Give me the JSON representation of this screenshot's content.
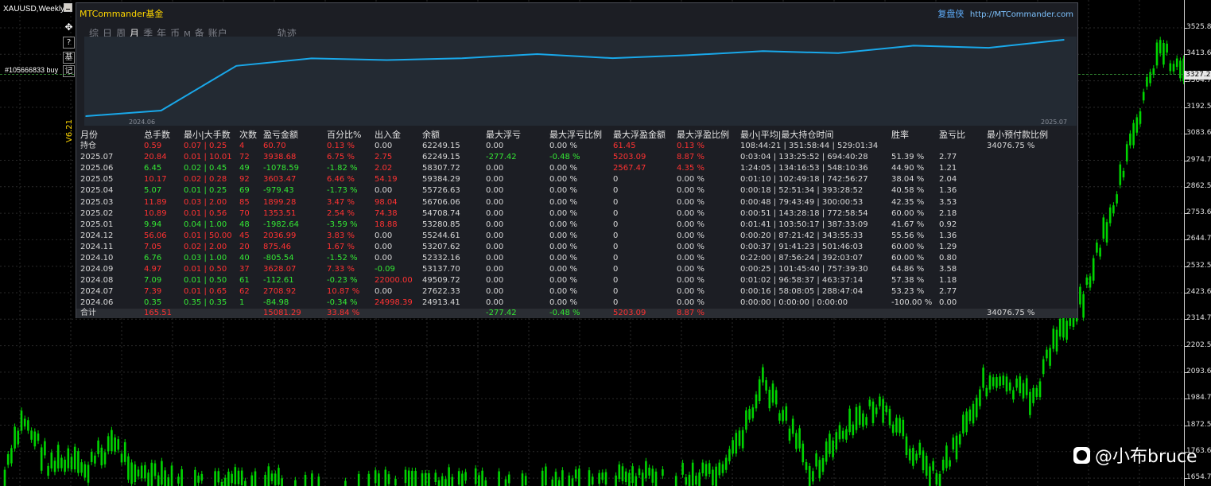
{
  "chart": {
    "symbol": "XAUUSD,Weekly",
    "order_label": "#105666833 buy",
    "version": "V6.21",
    "current_price": "3327.20",
    "price_ticks": [
      "3525.80",
      "3413.60",
      "3304.70",
      "3192.50",
      "3083.60",
      "2974.70",
      "2862.50",
      "2753.60",
      "2644.70",
      "2532.50",
      "2423.60",
      "2314.70",
      "2202.50",
      "2093.60",
      "1984.70",
      "1872.50",
      "1763.60",
      "1654.70"
    ],
    "side_buttons": {
      "move": "✥",
      "help": "?",
      "fund": "基",
      "record": "记"
    },
    "colors": {
      "candles": "#00d400",
      "grid": "#2a2a2a",
      "background": "#000000"
    }
  },
  "panel": {
    "brand": "MTCommander基金",
    "header_right_cn": "复盘侠",
    "header_right_url": "http://MTCommander.com",
    "tabs": [
      {
        "label": "综",
        "active": false
      },
      {
        "label": "日",
        "active": false
      },
      {
        "label": "周",
        "active": false
      },
      {
        "label": "月",
        "active": true
      },
      {
        "label": "季",
        "active": false
      },
      {
        "label": "年",
        "active": false
      },
      {
        "label": "币",
        "active": false
      },
      {
        "label": "M",
        "active": false
      },
      {
        "label": "备",
        "active": false
      },
      {
        "label": "账户",
        "active": false
      },
      {
        "label": "轨迹",
        "active": false
      }
    ],
    "equity": {
      "start_label": "2024.06",
      "end_label": "2025.07",
      "balances": [
        24913.41,
        27622.33,
        49509.72,
        53137.7,
        52332.16,
        53207.62,
        55244.61,
        53280.85,
        54708.74,
        56706.06,
        55726.63,
        59384.29,
        58307.72,
        62249.15
      ],
      "line_color": "#19a8ea"
    },
    "headers": [
      "月份",
      "总手数",
      "最小|大手数",
      "次数",
      "盈亏金额",
      "百分比%",
      "出入金",
      "余额",
      "最大浮亏",
      "最大浮亏比例",
      "最大浮盈金额",
      "最大浮盈比例",
      "最小|平均|最大持仓时间",
      "胜率",
      "盈亏比",
      "最小预付款比例"
    ],
    "rows": [
      {
        "c": [
          "持仓",
          "0.59",
          "0.07 | 0.25",
          "4",
          "60.70",
          "0.13 %",
          "0.00",
          "62249.15",
          "0.00",
          "0.00 %",
          "61.45",
          "0.13 %",
          "108:44:21 | 351:58:44 | 529:01:34",
          "",
          "",
          "34076.75 %"
        ],
        "k": [
          "w",
          "r",
          "r",
          "r",
          "r",
          "r",
          "w",
          "w",
          "w",
          "w",
          "r",
          "r",
          "w",
          "w",
          "w",
          "w"
        ]
      },
      {
        "c": [
          "2025.07",
          "20.84",
          "0.01 | 10.01",
          "72",
          "3938.68",
          "6.75 %",
          "2.75",
          "62249.15",
          "-277.42",
          "-0.48 %",
          "5203.09",
          "8.87 %",
          "0:03:04 | 133:25:52 | 694:40:28",
          "51.39 %",
          "2.77",
          ""
        ],
        "k": [
          "w",
          "r",
          "r",
          "r",
          "r",
          "r",
          "r",
          "w",
          "g",
          "g",
          "r",
          "r",
          "w",
          "w",
          "w",
          "w"
        ]
      },
      {
        "c": [
          "2025.06",
          "6.45",
          "0.02 | 0.45",
          "49",
          "-1078.59",
          "-1.82 %",
          "2.02",
          "58307.72",
          "0.00",
          "0.00 %",
          "2567.47",
          "4.35 %",
          "1:24:05 | 134:16:53 | 548:10:36",
          "44.90 %",
          "1.21",
          ""
        ],
        "k": [
          "w",
          "g",
          "g",
          "g",
          "g",
          "g",
          "r",
          "w",
          "w",
          "w",
          "r",
          "r",
          "w",
          "w",
          "w",
          "w"
        ]
      },
      {
        "c": [
          "2025.05",
          "10.17",
          "0.02 | 0.28",
          "92",
          "3603.47",
          "6.46 %",
          "54.19",
          "59384.29",
          "0.00",
          "0.00 %",
          "0",
          "0.00 %",
          "0:01:10 | 102:49:18 | 742:56:27",
          "38.04 %",
          "2.04",
          ""
        ],
        "k": [
          "w",
          "r",
          "r",
          "r",
          "r",
          "r",
          "r",
          "w",
          "w",
          "w",
          "w",
          "w",
          "w",
          "w",
          "w",
          "w"
        ]
      },
      {
        "c": [
          "2025.04",
          "5.07",
          "0.01 | 0.25",
          "69",
          "-979.43",
          "-1.73 %",
          "0.00",
          "55726.63",
          "0.00",
          "0.00 %",
          "0",
          "0.00 %",
          "0:00:18 | 52:51:34 | 393:28:52",
          "40.58 %",
          "1.36",
          ""
        ],
        "k": [
          "w",
          "g",
          "g",
          "g",
          "g",
          "g",
          "w",
          "w",
          "w",
          "w",
          "w",
          "w",
          "w",
          "w",
          "w",
          "w"
        ]
      },
      {
        "c": [
          "2025.03",
          "11.89",
          "0.03 | 2.00",
          "85",
          "1899.28",
          "3.47 %",
          "98.04",
          "56706.06",
          "0.00",
          "0.00 %",
          "0",
          "0.00 %",
          "0:00:48 | 79:43:49 | 300:00:53",
          "42.35 %",
          "3.53",
          ""
        ],
        "k": [
          "w",
          "r",
          "r",
          "r",
          "r",
          "r",
          "r",
          "w",
          "w",
          "w",
          "w",
          "w",
          "w",
          "w",
          "w",
          "w"
        ]
      },
      {
        "c": [
          "2025.02",
          "10.89",
          "0.01 | 0.56",
          "70",
          "1353.51",
          "2.54 %",
          "74.38",
          "54708.74",
          "0.00",
          "0.00 %",
          "0",
          "0.00 %",
          "0:00:51 | 143:28:18 | 772:58:54",
          "60.00 %",
          "2.18",
          ""
        ],
        "k": [
          "w",
          "r",
          "r",
          "r",
          "r",
          "r",
          "r",
          "w",
          "w",
          "w",
          "w",
          "w",
          "w",
          "w",
          "w",
          "w"
        ]
      },
      {
        "c": [
          "2025.01",
          "9.94",
          "0.04 | 1.00",
          "48",
          "-1982.64",
          "-3.59 %",
          "18.88",
          "53280.85",
          "0.00",
          "0.00 %",
          "0",
          "0.00 %",
          "0:01:41 | 103:50:17 | 387:33:09",
          "41.67 %",
          "0.92",
          ""
        ],
        "k": [
          "w",
          "g",
          "g",
          "g",
          "g",
          "g",
          "r",
          "w",
          "w",
          "w",
          "w",
          "w",
          "w",
          "w",
          "w",
          "w"
        ]
      },
      {
        "c": [
          "2024.12",
          "56.06",
          "0.01 | 50.00",
          "45",
          "2036.99",
          "3.83 %",
          "0.00",
          "55244.61",
          "0.00",
          "0.00 %",
          "0",
          "0.00 %",
          "0:00:20 | 87:21:42 | 343:55:33",
          "55.56 %",
          "1.36",
          ""
        ],
        "k": [
          "w",
          "r",
          "r",
          "r",
          "r",
          "r",
          "w",
          "w",
          "w",
          "w",
          "w",
          "w",
          "w",
          "w",
          "w",
          "w"
        ]
      },
      {
        "c": [
          "2024.11",
          "7.05",
          "0.02 | 2.00",
          "20",
          "875.46",
          "1.67 %",
          "0.00",
          "53207.62",
          "0.00",
          "0.00 %",
          "0",
          "0.00 %",
          "0:00:37 | 91:41:23 | 501:46:03",
          "60.00 %",
          "1.29",
          ""
        ],
        "k": [
          "w",
          "r",
          "r",
          "r",
          "r",
          "r",
          "w",
          "w",
          "w",
          "w",
          "w",
          "w",
          "w",
          "w",
          "w",
          "w"
        ]
      },
      {
        "c": [
          "2024.10",
          "6.76",
          "0.03 | 1.00",
          "40",
          "-805.54",
          "-1.52 %",
          "0.00",
          "52332.16",
          "0.00",
          "0.00 %",
          "0",
          "0.00 %",
          "0:22:00 | 87:56:24 | 392:03:07",
          "60.00 %",
          "0.80",
          ""
        ],
        "k": [
          "w",
          "g",
          "g",
          "g",
          "g",
          "g",
          "w",
          "w",
          "w",
          "w",
          "w",
          "w",
          "w",
          "w",
          "w",
          "w"
        ]
      },
      {
        "c": [
          "2024.09",
          "4.97",
          "0.01 | 0.50",
          "37",
          "3628.07",
          "7.33 %",
          "-0.09",
          "53137.70",
          "0.00",
          "0.00 %",
          "0",
          "0.00 %",
          "0:00:25 | 101:45:40 | 757:39:30",
          "64.86 %",
          "3.58",
          ""
        ],
        "k": [
          "w",
          "r",
          "r",
          "r",
          "r",
          "r",
          "g",
          "w",
          "w",
          "w",
          "w",
          "w",
          "w",
          "w",
          "w",
          "w"
        ]
      },
      {
        "c": [
          "2024.08",
          "7.09",
          "0.01 | 0.50",
          "61",
          "-112.61",
          "-0.23 %",
          "22000.00",
          "49509.72",
          "0.00",
          "0.00 %",
          "0",
          "0.00 %",
          "0:01:02 | 96:58:37 | 463:37:14",
          "57.38 %",
          "1.18",
          ""
        ],
        "k": [
          "w",
          "g",
          "g",
          "g",
          "g",
          "g",
          "r",
          "w",
          "w",
          "w",
          "w",
          "w",
          "w",
          "w",
          "w",
          "w"
        ]
      },
      {
        "c": [
          "2024.07",
          "7.39",
          "0.01 | 0.65",
          "62",
          "2708.92",
          "10.87 %",
          "0.00",
          "27622.33",
          "0.00",
          "0.00 %",
          "0",
          "0.00 %",
          "0:00:16 | 58:08:05 | 288:47:04",
          "53.23 %",
          "2.77",
          ""
        ],
        "k": [
          "w",
          "r",
          "r",
          "r",
          "r",
          "r",
          "w",
          "w",
          "w",
          "w",
          "w",
          "w",
          "w",
          "w",
          "w",
          "w"
        ]
      },
      {
        "c": [
          "2024.06",
          "0.35",
          "0.35 | 0.35",
          "1",
          "-84.98",
          "-0.34 %",
          "24998.39",
          "24913.41",
          "0.00",
          "0.00 %",
          "0",
          "0.00 %",
          "0:00:00 | 0:00:00 | 0:00:00",
          "-100.00 %",
          "0.00",
          ""
        ],
        "k": [
          "w",
          "g",
          "g",
          "g",
          "g",
          "g",
          "r",
          "w",
          "w",
          "w",
          "w",
          "w",
          "w",
          "w",
          "w",
          "w"
        ]
      }
    ],
    "total": {
      "c": [
        "合计",
        "165.51",
        "",
        "",
        "15081.29",
        "33.84 %",
        "",
        "",
        "-277.42",
        "-0.48 %",
        "5203.09",
        "8.87 %",
        "",
        "",
        "",
        "34076.75 %"
      ],
      "k": [
        "w",
        "r",
        "w",
        "w",
        "r",
        "r",
        "w",
        "w",
        "g",
        "g",
        "r",
        "r",
        "w",
        "w",
        "w",
        "w"
      ]
    }
  },
  "watermark": {
    "text": "@小布bruce"
  }
}
